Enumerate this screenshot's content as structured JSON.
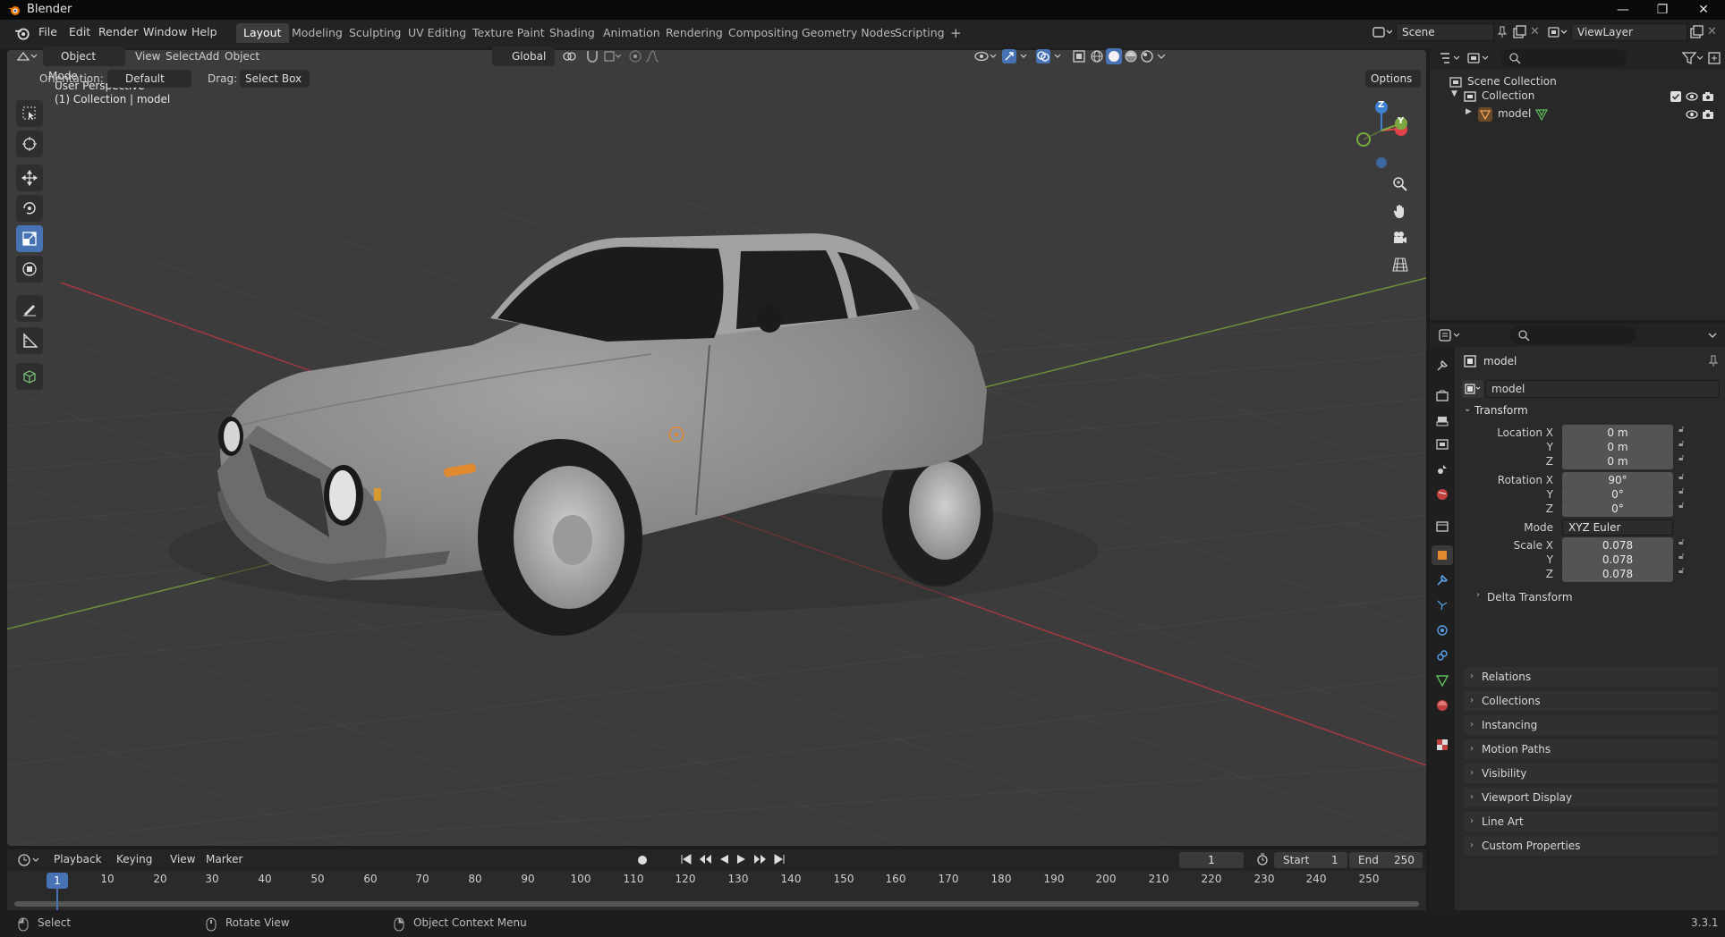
{
  "window": {
    "title": "Blender",
    "controls": [
      "—",
      "❐",
      "✕"
    ]
  },
  "menu": {
    "items": [
      "File",
      "Edit",
      "Render",
      "Window",
      "Help"
    ]
  },
  "workspaces": {
    "tabs": [
      "Layout",
      "Modeling",
      "Sculpting",
      "UV Editing",
      "Texture Paint",
      "Shading",
      "Animation",
      "Rendering",
      "Compositing",
      "Geometry Nodes",
      "Scripting"
    ],
    "active": "Layout",
    "add": "+"
  },
  "scene": {
    "name": "Scene",
    "view_layer": "ViewLayer"
  },
  "viewport": {
    "mode": "Object Mode",
    "menus": [
      "View",
      "Select",
      "Add",
      "Object"
    ],
    "transform_space": "Global",
    "orientation_label": "Orientation:",
    "orientation_value": "Default",
    "drag_label": "Drag:",
    "drag_value": "Select Box",
    "options_label": "Options",
    "overlay_line1": "User Perspective",
    "overlay_line2": "(1) Collection | model",
    "gizmo": {
      "z": "Z",
      "y": "Y"
    }
  },
  "outliner": {
    "title": "Scene Collection",
    "items": [
      {
        "label": "Collection"
      },
      {
        "label": "model"
      }
    ]
  },
  "properties": {
    "object_name": "model",
    "datablock_name": "model",
    "transform_header": "Transform",
    "location": {
      "label_x": "Location X",
      "x": "0 m",
      "y": "0 m",
      "z": "0 m"
    },
    "rotation": {
      "label_x": "Rotation X",
      "x": "90°",
      "y": "0°",
      "z": "0°"
    },
    "mode_label": "Mode",
    "mode_value": "XYZ Euler",
    "scale": {
      "label_x": "Scale X",
      "x": "0.078",
      "y": "0.078",
      "z": "0.078"
    },
    "axis_labels": {
      "y": "Y",
      "z": "Z"
    },
    "delta_transform": "Delta Transform",
    "panels": [
      "Relations",
      "Collections",
      "Instancing",
      "Motion Paths",
      "Visibility",
      "Viewport Display",
      "Line Art",
      "Custom Properties"
    ]
  },
  "timeline": {
    "menus": [
      "Playback",
      "Keying",
      "View",
      "Marker"
    ],
    "current_frame": "1",
    "start_label": "Start",
    "start_value": "1",
    "end_label": "End",
    "end_value": "250",
    "frame_marks": [
      "10",
      "20",
      "30",
      "40",
      "50",
      "60",
      "70",
      "80",
      "90",
      "100",
      "110",
      "120",
      "130",
      "140",
      "150",
      "160",
      "170",
      "180",
      "190",
      "200",
      "210",
      "220",
      "230",
      "240",
      "250"
    ],
    "playhead": "1"
  },
  "statusbar": {
    "hints": [
      "Select",
      "Rotate View",
      "Object Context Menu"
    ],
    "version": "3.3.1"
  },
  "colors": {
    "accent": "#4772b3",
    "axis_x": "#e2434b",
    "axis_y": "#7ba83f",
    "axis_z": "#3f7fd1",
    "object_orange": "#e28a30"
  }
}
